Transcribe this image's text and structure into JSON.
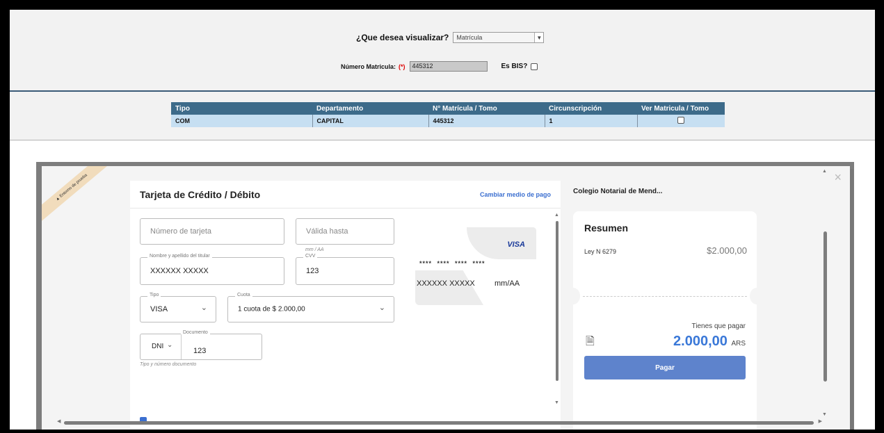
{
  "form": {
    "visualize_label": "¿Que desea visualizar?",
    "visualize_value": "Matrícula",
    "numero_label": "Número Matricula:",
    "required_mark": "(*)",
    "numero_value": "445312",
    "bis_label": "Es BIS?"
  },
  "table": {
    "headers": [
      "Tipo",
      "Departamento",
      "N° Matrícula / Tomo",
      "Circunscripción",
      "Ver Matricula / Tomo"
    ],
    "rows": [
      [
        "COM",
        "CAPITAL",
        "445312",
        "1"
      ]
    ]
  },
  "modal": {
    "ribbon": "▲ Entorno de prueba",
    "card_title": "Tarjeta de Crédito / Débito",
    "change_payment": "Cambiar medio de pago",
    "card_number_placeholder": "Número de tarjeta",
    "valid_until_placeholder": "Válida hasta",
    "valid_hint": "mm / AA",
    "holder_legend": "Nombre y apellido del titular",
    "holder_value": "XXXXXX XXXXX",
    "cvv_legend": "CVV",
    "cvv_value": "123",
    "tipo_legend": "Tipo",
    "tipo_value": "VISA",
    "cuota_legend": "Cuota",
    "cuota_value": "1 cuota de $ 2.000,00",
    "doc_type": "DNI",
    "doc_legend": "Documento",
    "doc_value": "123",
    "doc_hint": "Tipo y número documento",
    "visa_logo": "VISA",
    "card_stars": "**** **** **** ****",
    "card_name": "XXXXXX XXXXX",
    "card_exp": "mm/AA"
  },
  "summary": {
    "merchant": "Colegio Notarial de Mend...",
    "title": "Resumen",
    "item_label": "Ley N 6279",
    "item_amount": "$2.000,00",
    "to_pay_label": "Tienes que pagar",
    "total": "2.000,00",
    "currency": "ARS",
    "pay_button": "Pagar"
  }
}
